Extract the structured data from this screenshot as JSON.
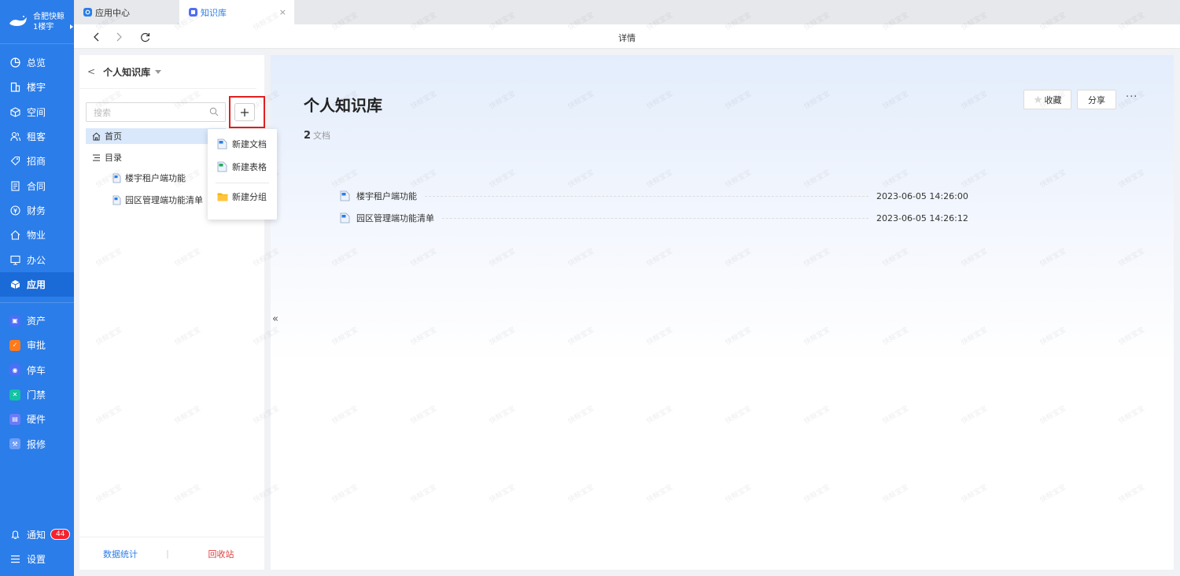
{
  "brand": {
    "name": "合肥快鲸",
    "building": "1楼宇"
  },
  "nav": {
    "items": [
      {
        "label": "总览",
        "icon": "dashboard-icon"
      },
      {
        "label": "楼宇",
        "icon": "building-icon"
      },
      {
        "label": "空间",
        "icon": "cube-icon"
      },
      {
        "label": "租客",
        "icon": "users-icon"
      },
      {
        "label": "招商",
        "icon": "tag-icon"
      },
      {
        "label": "合同",
        "icon": "contract-icon"
      },
      {
        "label": "财务",
        "icon": "finance-icon"
      },
      {
        "label": "物业",
        "icon": "home-icon"
      },
      {
        "label": "办公",
        "icon": "monitor-icon"
      },
      {
        "label": "应用",
        "icon": "app-cube-icon"
      }
    ],
    "apps": [
      {
        "label": "资产",
        "color": "#4f6ef7"
      },
      {
        "label": "审批",
        "color": "#ff7a1a"
      },
      {
        "label": "停车",
        "color": "#4f6ef7"
      },
      {
        "label": "门禁",
        "color": "#13c2a3"
      },
      {
        "label": "硬件",
        "color": "#6b7cf7"
      },
      {
        "label": "报修",
        "color": "#6b9cf7"
      }
    ],
    "notify_label": "通知",
    "notify_count": "44",
    "settings_label": "设置"
  },
  "tabs": [
    {
      "label": "应用中心"
    },
    {
      "label": "知识库",
      "close": "×"
    }
  ],
  "toolbar": {
    "title": "详情"
  },
  "kb": {
    "title": "个人知识库",
    "search_placeholder": "搜索",
    "home_label": "首页",
    "catalog_label": "目录",
    "docs": [
      "楼宇租户端功能",
      "园区管理端功能清单"
    ],
    "footer_stats": "数据统计",
    "footer_sep": "|",
    "footer_trash": "回收站"
  },
  "menu": {
    "new_doc": "新建文档",
    "new_sheet": "新建表格",
    "new_group": "新建分组"
  },
  "main": {
    "title": "个人知识库",
    "count": "2",
    "count_label": "文档",
    "favorite_label": "收藏",
    "share_label": "分享",
    "more_label": "···",
    "docs": [
      {
        "name": "楼宇租户端功能",
        "time": "2023-06-05 14:26:00"
      },
      {
        "name": "园区管理端功能清单",
        "time": "2023-06-05 14:26:12"
      }
    ]
  },
  "collapse_label": "«",
  "watermark": "快鲸宝宝",
  "colors": {
    "primary": "#2b7de9",
    "danger": "#e02020"
  }
}
